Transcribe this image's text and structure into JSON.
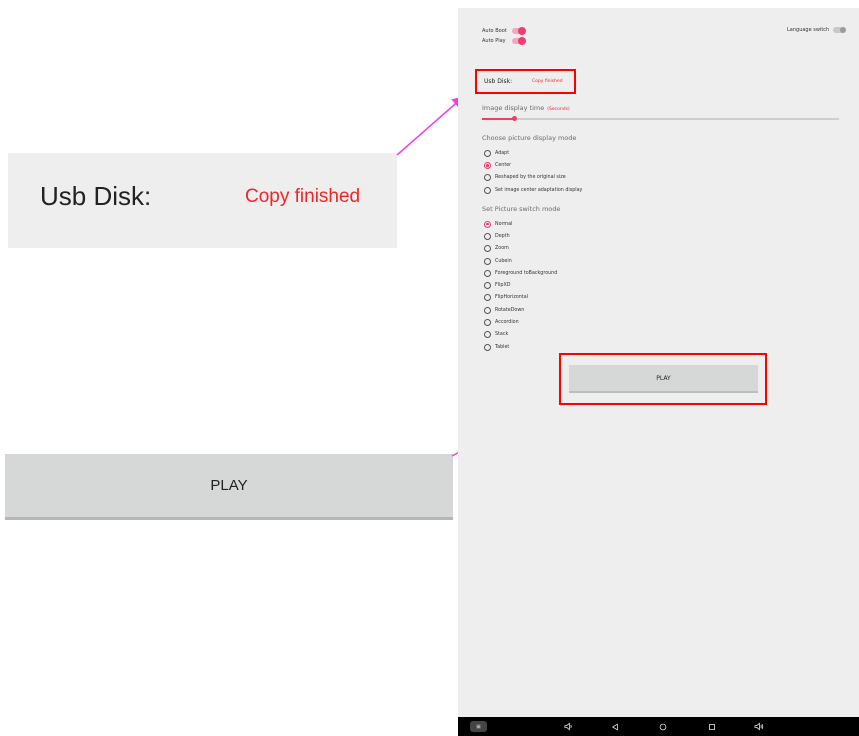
{
  "zoom_usb": {
    "label": "Usb Disk:",
    "status": "Copy finished"
  },
  "zoom_play": {
    "label": "PLAY"
  },
  "settings": {
    "auto_boot": {
      "label": "Auto Boot",
      "enabled": true
    },
    "auto_play": {
      "label": "Auto Play",
      "enabled": true
    },
    "language_switch": {
      "label": "Language switch",
      "enabled": false
    },
    "usb_disk": {
      "label": "Usb Disk:",
      "status": "Copy finished"
    },
    "image_display_time": {
      "title": "Image display time",
      "unit_note": "(Seconds)",
      "slider_value_fraction": 0.09
    },
    "display_mode": {
      "title": "Choose picture display mode",
      "options": [
        {
          "label": "Adapt",
          "checked": false
        },
        {
          "label": "Center",
          "checked": true
        },
        {
          "label": "Reshaped by the original size",
          "checked": false
        },
        {
          "label": "Set image center adaptation display",
          "checked": false
        }
      ]
    },
    "switch_mode": {
      "title": "Set Picture switch mode",
      "options": [
        {
          "label": "Normal",
          "checked": true
        },
        {
          "label": "Depth",
          "checked": false
        },
        {
          "label": "Zoom",
          "checked": false
        },
        {
          "label": "Cubein",
          "checked": false
        },
        {
          "label": "Foreground toBackground",
          "checked": false
        },
        {
          "label": "FlipXD",
          "checked": false
        },
        {
          "label": "FlipHorizontal",
          "checked": false
        },
        {
          "label": "RotateDown",
          "checked": false
        },
        {
          "label": "Accordion",
          "checked": false
        },
        {
          "label": "Stack",
          "checked": false
        },
        {
          "label": "Tablet",
          "checked": false
        }
      ]
    },
    "play_button": {
      "label": "PLAY"
    }
  },
  "navbar": {
    "icons": [
      "screenshot-icon",
      "volume-down-icon",
      "back-icon",
      "home-icon",
      "recents-icon",
      "volume-up-icon"
    ]
  },
  "colors": {
    "accent": "#ef3d6e",
    "highlight": "#ff0000",
    "status_text": "#ee2626",
    "arrow": "#f13fe0"
  }
}
